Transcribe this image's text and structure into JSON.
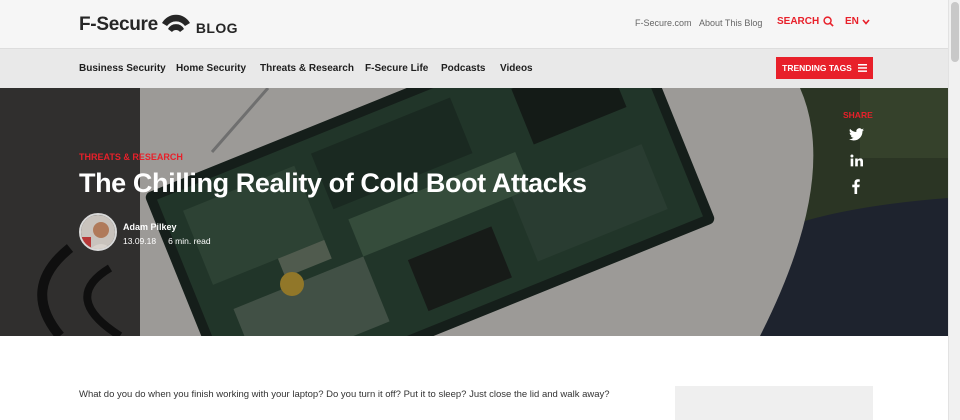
{
  "header": {
    "logo_text": "F-Secure",
    "logo_blog": "BLOG",
    "links": [
      "F-Secure.com",
      "About This Blog"
    ],
    "search_label": "SEARCH",
    "lang_label": "EN"
  },
  "nav": {
    "items": [
      "Business Security",
      "Home Security",
      "Threats & Research",
      "F-Secure Life",
      "Podcasts",
      "Videos"
    ],
    "trending_label": "TRENDING TAGS"
  },
  "hero": {
    "category": "THREATS & RESEARCH",
    "title": "The Chilling Reality of Cold Boot Attacks",
    "author": "Adam Pilkey",
    "date": "13.09.18",
    "read_time": "6 min. read",
    "share_label": "SHARE"
  },
  "article": {
    "intro": "What do you do when you finish working with your laptop? Do you turn it off? Put it to sleep? Just close the lid and walk away?"
  },
  "colors": {
    "accent": "#e8202a",
    "hero_bg": "#3f3e3c"
  },
  "icons": {
    "search": "search-icon",
    "lang": "chevron-down-icon",
    "trending": "menu-icon",
    "share": [
      "twitter-icon",
      "linkedin-icon",
      "facebook-icon"
    ]
  }
}
